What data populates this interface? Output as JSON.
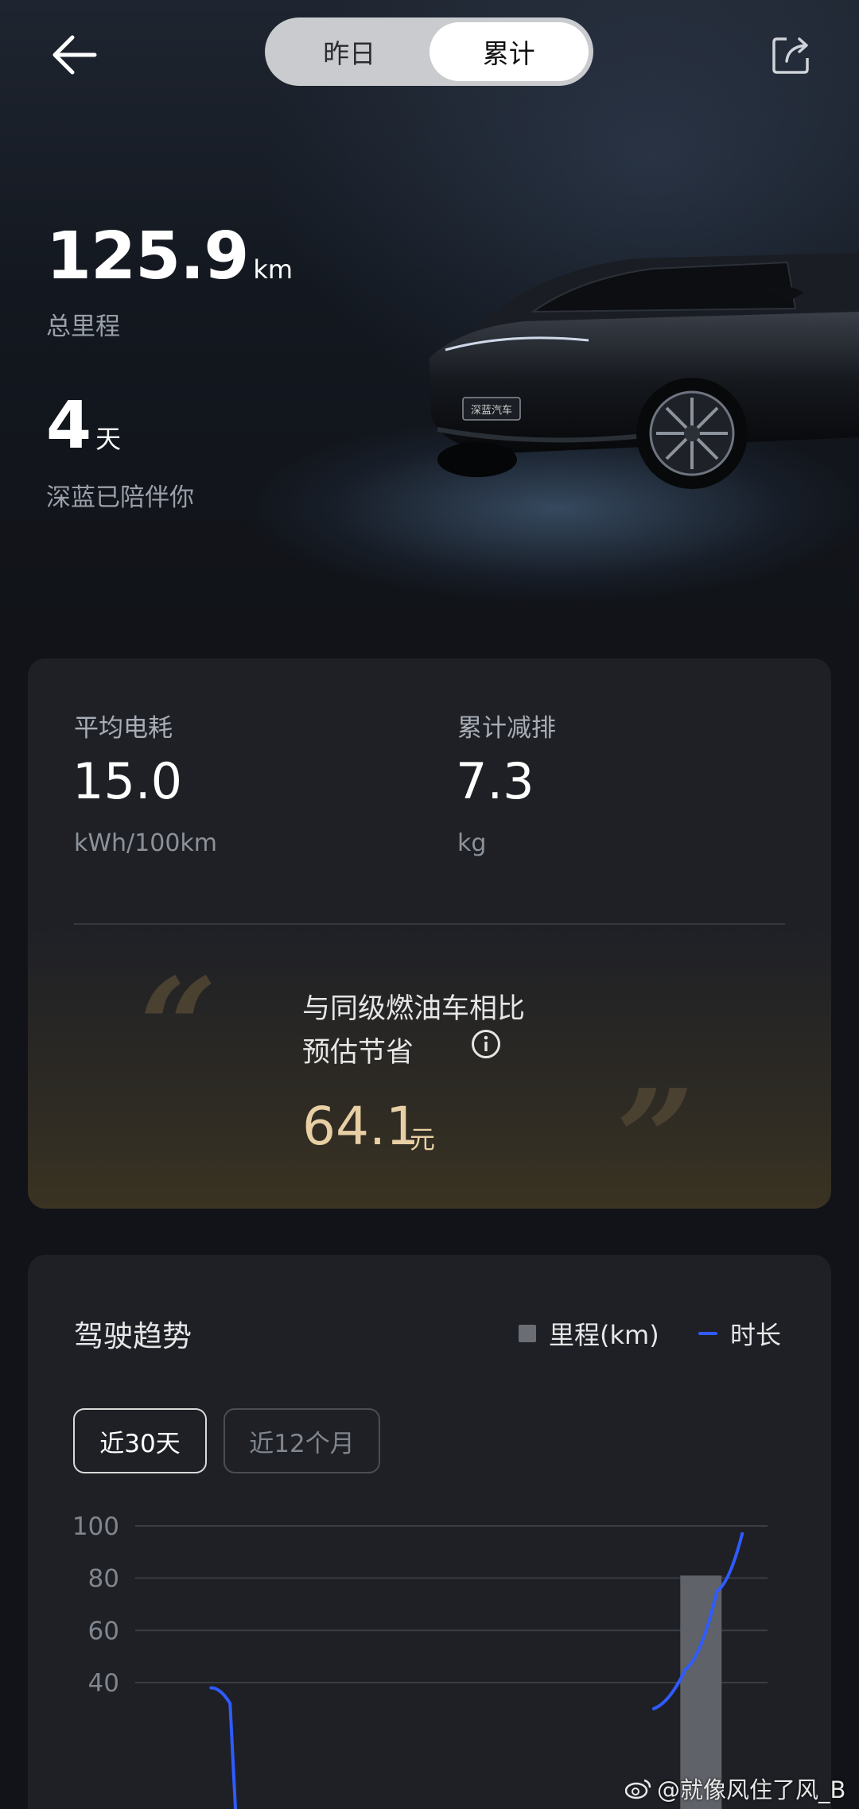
{
  "header": {
    "tabs": [
      {
        "label": "昨日",
        "active": false
      },
      {
        "label": "累计",
        "active": true
      }
    ]
  },
  "hero": {
    "mileage_value": "125.9",
    "mileage_unit": "km",
    "mileage_caption": "总里程",
    "days_value": "4",
    "days_unit": "天",
    "days_caption": "深蓝已陪伴你",
    "car_plate": "深蓝汽车"
  },
  "metrics": {
    "avg_consumption_label": "平均电耗",
    "avg_consumption_value": "15.0",
    "avg_consumption_unit": "kWh/100km",
    "emission_label": "累计减排",
    "emission_value": "7.3",
    "emission_unit": "kg"
  },
  "savings": {
    "line1": "与同级燃油车相比",
    "line2": "预估节省",
    "value": "64.1",
    "unit": "元"
  },
  "trend": {
    "title": "驾驶趋势",
    "legend_mileage": "里程(km)",
    "legend_duration": "时长",
    "range_30d": "近30天",
    "range_12m": "近12个月"
  },
  "chart_data": {
    "type": "bar",
    "y_ticks": [
      100,
      80,
      60,
      40
    ],
    "ylim": [
      0,
      100
    ],
    "series": [
      {
        "name": "里程(km)",
        "type": "bar",
        "bar_value": 81
      },
      {
        "name": "时长",
        "type": "line",
        "visible_points": [
          [
            0.12,
            38
          ],
          [
            0.15,
            32
          ],
          [
            0.82,
            30
          ],
          [
            0.87,
            45
          ],
          [
            0.92,
            75
          ],
          [
            0.96,
            97
          ]
        ]
      }
    ]
  },
  "watermark": "@就像风住了风_B",
  "colors": {
    "accent_gold": "#e8cfa4",
    "line_blue": "#2f5bff",
    "bar_gray": "#6a6d73"
  }
}
